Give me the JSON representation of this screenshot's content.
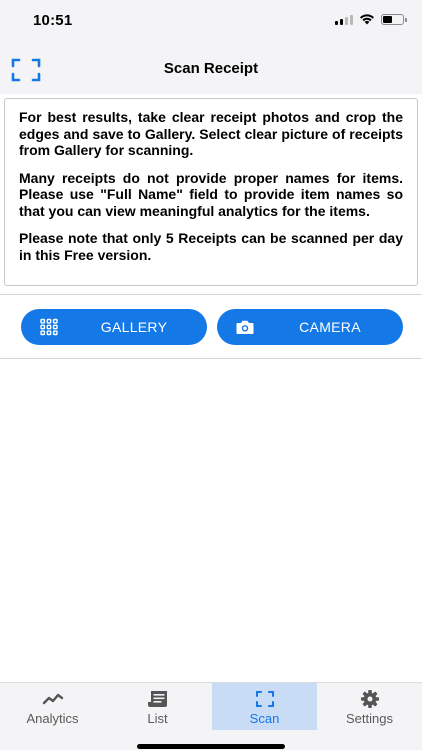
{
  "status": {
    "time": "10:51"
  },
  "header": {
    "title": "Scan Receipt"
  },
  "info": {
    "paragraphs": [
      "For best results, take clear receipt photos and crop the edges and save to Gallery. Select clear picture of receipts from Gallery for scanning.",
      "Many receipts do not provide proper names for items. Please use \"Full Name\" field to provide item names so that you can view meaningful analytics for the items.",
      "Please note that only 5 Receipts can be scanned per day in this Free version."
    ]
  },
  "actions": {
    "gallery_label": "GALLERY",
    "camera_label": "CAMERA"
  },
  "tabs": [
    {
      "label": "Analytics",
      "icon": "analytics-icon"
    },
    {
      "label": "List",
      "icon": "list-icon"
    },
    {
      "label": "Scan",
      "icon": "scan-icon",
      "active": true
    },
    {
      "label": "Settings",
      "icon": "gear-icon"
    }
  ],
  "colors": {
    "accent": "#1479e6",
    "active_tab_bg": "#c8dcf6",
    "bar_bg": "#f4f4f6"
  }
}
